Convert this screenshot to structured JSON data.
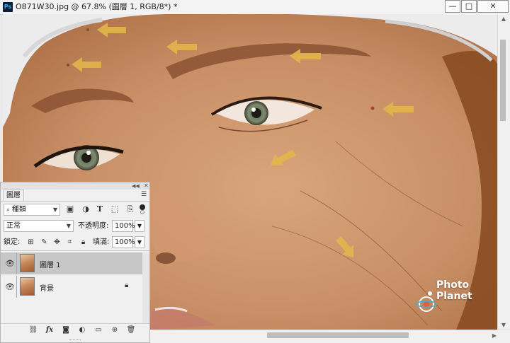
{
  "window": {
    "app_badge": "Ps",
    "title": "O871W30.jpg @ 67.8% (圖層 1, RGB/8*) *",
    "minimize": "—",
    "maximize": "□",
    "close": "✕"
  },
  "canvas": {
    "watermark_line1": "Photo",
    "watermark_line2": "Planet",
    "arrow_color": "#e2b64a",
    "skin_color": "#c79068",
    "hat_color": "#ebebeb"
  },
  "layers_panel": {
    "tab_label": "圖層",
    "filter_kind": "種類",
    "blend_mode": "正常",
    "opacity_label": "不透明度:",
    "opacity_value": "100%",
    "lock_label": "鎖定:",
    "fill_label": "填滿:",
    "fill_value": "100%",
    "layers": [
      {
        "name": "圖層 1",
        "selected": true,
        "locked": false
      },
      {
        "name": "背景",
        "selected": false,
        "locked": true
      }
    ],
    "filter_icons": [
      "image-filter-icon",
      "adjustment-filter-icon",
      "type-filter-icon",
      "shape-filter-icon",
      "smart-object-filter-icon"
    ],
    "bottom_icons": [
      "link-icon",
      "fx-icon",
      "mask-icon",
      "adjustment-layer-icon",
      "group-icon",
      "new-layer-icon",
      "trash-icon"
    ]
  }
}
